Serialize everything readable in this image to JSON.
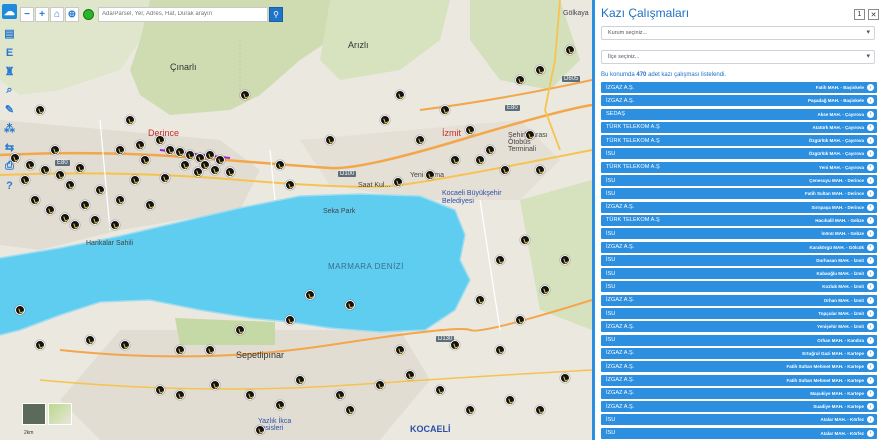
{
  "map": {
    "search_placeholder": "Ada/Parsel, Yer, Adres, Hat, Durak arayın",
    "labels": {
      "cinarli": "Çınarlı",
      "arızlı": "Arızlı",
      "derince": "Derince",
      "izmit": "İzmit",
      "gölkaya": "Gölkaya",
      "marmara": "MARMARA DENİZİ",
      "seka_park": "Seka Park",
      "saat_kulesi": "Saat Kul...",
      "yeni_cuma": "Yeni Cuma",
      "kocaeli_bb": "Kocaeli Büyükşehir Belediyesi",
      "sepetlipinar": "Sepetlipınar",
      "harikalar": "Harikalar Sahili",
      "sehirlerarasi": "Şehirlerarası Otobüs Terminali",
      "yazlik": "Yazlık İkca Tesisleri",
      "kocaeli_logo": "KOCAELİ",
      "road_d100": "D100",
      "road_e80": "E80",
      "road_e80b": "E80",
      "road_d605": "D605",
      "road_d130": "D130",
      "scale": "2km"
    },
    "icons": {
      "zoom_out": "minus-icon",
      "zoom_in": "plus-icon",
      "home": "home-icon",
      "locate": "crosshair-icon",
      "search": "search-icon"
    }
  },
  "panel": {
    "title": "Kazı Çalışmaları",
    "btn_one": "1",
    "btn_close": "✕",
    "kurum_placeholder": "Kurum seçiniz...",
    "ilce_placeholder": "İlçe seçiniz...",
    "info_prefix": "Bu konumda",
    "info_count": "470",
    "info_suffix": "adet kazı çalışması listelendi.",
    "items": [
      {
        "kurum": "İZGAZ A.Ş.",
        "yer": "Fatih MAH. - Başiskele"
      },
      {
        "kurum": "İZGAZ A.Ş.",
        "yer": "Paşadağ MAH. - Başiskele"
      },
      {
        "kurum": "SEDAŞ",
        "yer": "Akse MAH. - Çayırova"
      },
      {
        "kurum": "TÜRK TELEKOM A.Ş",
        "yer": "Atatürk MAH. - Çayırova"
      },
      {
        "kurum": "TÜRK TELEKOM A.Ş",
        "yer": "Özgürlük MAH. - Çayırova"
      },
      {
        "kurum": "İSU",
        "yer": "Özgürlük MAH. - Çayırova"
      },
      {
        "kurum": "TÜRK TELEKOM A.Ş",
        "yer": "Yeni MAH. - Çayırova"
      },
      {
        "kurum": "İSU",
        "yer": "Çenesuyu MAH. - Derince"
      },
      {
        "kurum": "İSU",
        "yer": "Fatih Sultan MAH. - Derince"
      },
      {
        "kurum": "İZGAZ A.Ş.",
        "yer": "Sırrıpaşa MAH. - Derince"
      },
      {
        "kurum": "TÜRK TELEKOM A.Ş",
        "yer": "Hacıhalil MAH. - Gebze"
      },
      {
        "kurum": "İSU",
        "yer": "İnönü MAH. - Gebze"
      },
      {
        "kurum": "İZGAZ A.Ş.",
        "yer": "Karakörgü MAH. - Gölcük"
      },
      {
        "kurum": "İSU",
        "yer": "Durhasan MAH. - İzmit"
      },
      {
        "kurum": "İSU",
        "yer": "Kabaoğlu MAH. - İzmit"
      },
      {
        "kurum": "İSU",
        "yer": "Kozluk MAH. - İzmit"
      },
      {
        "kurum": "İZGAZ A.Ş.",
        "yer": "Orhan MAH. - İzmit"
      },
      {
        "kurum": "İSU",
        "yer": "Topçular MAH. - İzmit"
      },
      {
        "kurum": "İZGAZ A.Ş.",
        "yer": "Yenişehir MAH. - İzmit"
      },
      {
        "kurum": "İSU",
        "yer": "Orhan MAH. - Kandıra"
      },
      {
        "kurum": "İZGAZ A.Ş.",
        "yer": "Ertuğrul Gazi MAH. - Kartepe"
      },
      {
        "kurum": "İZGAZ A.Ş.",
        "yer": "Fatih Sultan Mehmet MAH. - Kartepe"
      },
      {
        "kurum": "İZGAZ A.Ş.",
        "yer": "Fatih Sultan Mehmet MAH. - Kartepe"
      },
      {
        "kurum": "İZGAZ A.Ş.",
        "yer": "Maşukiye MAH. - Kartepe"
      },
      {
        "kurum": "İZGAZ A.Ş.",
        "yer": "Suadiye MAH. - Kartepe"
      },
      {
        "kurum": "İSU",
        "yer": "Atalar MAH. - Körfez"
      },
      {
        "kurum": "İSU",
        "yer": "Atalar MAH. - Körfez"
      }
    ]
  }
}
